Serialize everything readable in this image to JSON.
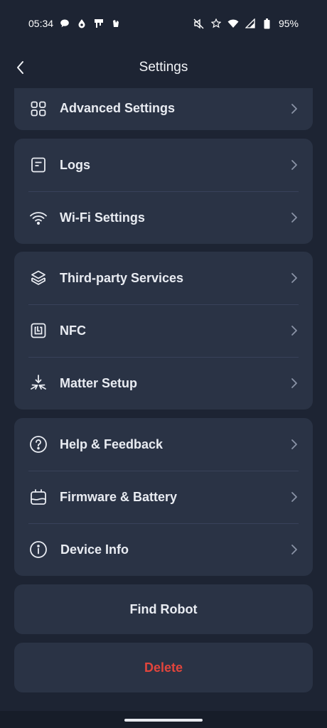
{
  "status_bar": {
    "time": "05:34",
    "battery": "95%",
    "icons_left": [
      "chat-bubble-icon",
      "drop-icon",
      "stamp-icon",
      "app-icon"
    ],
    "icons_right": [
      "mute-icon",
      "star-icon",
      "wifi-icon",
      "cell-signal-icon",
      "battery-icon"
    ]
  },
  "header": {
    "title": "Settings",
    "back_icon": "chevron-left-icon"
  },
  "groups": [
    {
      "items": [
        {
          "label": "Advanced Settings",
          "icon": "grid-icon"
        }
      ]
    },
    {
      "items": [
        {
          "label": "Logs",
          "icon": "document-icon"
        },
        {
          "label": "Wi-Fi Settings",
          "icon": "wifi-icon"
        }
      ]
    },
    {
      "items": [
        {
          "label": "Third-party Services",
          "icon": "layers-icon"
        },
        {
          "label": "NFC",
          "icon": "nfc-icon"
        },
        {
          "label": "Matter Setup",
          "icon": "matter-icon"
        }
      ]
    },
    {
      "items": [
        {
          "label": "Help & Feedback",
          "icon": "question-circle-icon"
        },
        {
          "label": "Firmware & Battery",
          "icon": "firmware-icon"
        },
        {
          "label": "Device Info",
          "icon": "info-circle-icon"
        }
      ]
    }
  ],
  "actions": {
    "find_robot": "Find Robot",
    "delete": "Delete"
  },
  "colors": {
    "background": "#1d2433",
    "card": "#2a3345",
    "text": "#e9ecf2",
    "delete_red": "#e2453c",
    "chevron": "#8a93a6"
  }
}
